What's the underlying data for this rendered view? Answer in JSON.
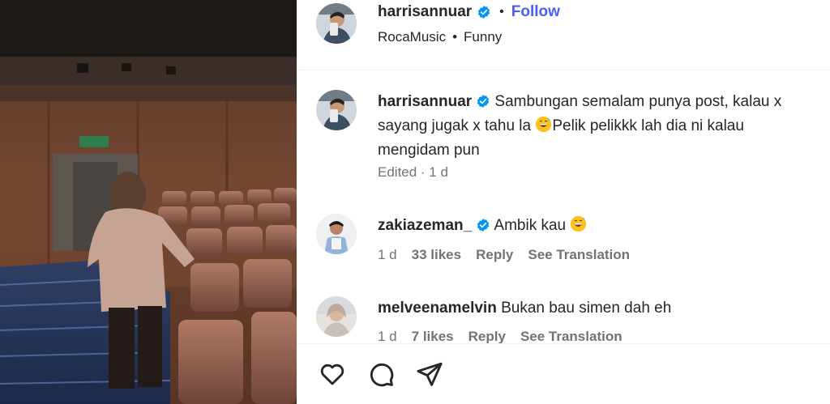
{
  "post": {
    "author": {
      "username": "harrisannuar",
      "verified": true,
      "follow_label": "Follow",
      "separator": "•"
    },
    "audio": {
      "artist": "RocaMusic",
      "separator": "•",
      "track": "Funny"
    },
    "caption": {
      "username": "harrisannuar",
      "text_part1": " Sambungan semalam punya post, kalau x sayang jugak x tahu la ",
      "text_part2": "Pelik pelikkk lah dia ni kalau mengidam pun",
      "meta": "Edited · 1 d"
    }
  },
  "comments": [
    {
      "username": "zakiazeman_",
      "verified": true,
      "text": " Ambik kau ",
      "time": "1 d",
      "likes": "33 likes",
      "reply_label": "Reply",
      "translate_label": "See Translation"
    },
    {
      "username": "melveenamelvin",
      "verified": false,
      "text": " Bukan bau simen dah eh",
      "time": "1 d",
      "likes": "7 likes",
      "reply_label": "Reply",
      "translate_label": "See Translation"
    }
  ],
  "icons": {
    "like": "heart-icon",
    "comment": "comment-bubble-icon",
    "share": "paper-plane-icon",
    "verified": "verified-badge-icon",
    "emoji": "grinning-sweat-emoji"
  },
  "colors": {
    "follow_blue": "#4a5df9",
    "verified_blue": "#0095f6",
    "muted_text": "#737373",
    "primary_text": "#262626"
  }
}
